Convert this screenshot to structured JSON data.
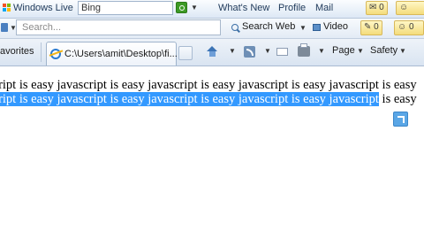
{
  "live_toolbar": {
    "title": "Windows Live",
    "search_value": "Bing",
    "links": [
      "What's New",
      "Profile",
      "Mail"
    ],
    "badge_count": "0"
  },
  "search_bar": {
    "placeholder": "Search...",
    "search_web_label": "Search Web",
    "video_label": "Video",
    "badge_count": "0"
  },
  "command_bar": {
    "favorites_label": "avorites",
    "tab_title": "C:\\Users\\amit\\Desktop\\fi...",
    "page_label": "Page",
    "safety_label": "Safety"
  },
  "page": {
    "line1": "script is easy javascript is easy javascript is easy javascript is easy javascript is easy",
    "line2_selected": "script is easy javascript is easy javascript is easy javascript is easy javascript",
    "line2_rest": " is easy"
  },
  "colors": {
    "selection": "#3399ff",
    "toolbar_bg": "#dde8f5"
  }
}
